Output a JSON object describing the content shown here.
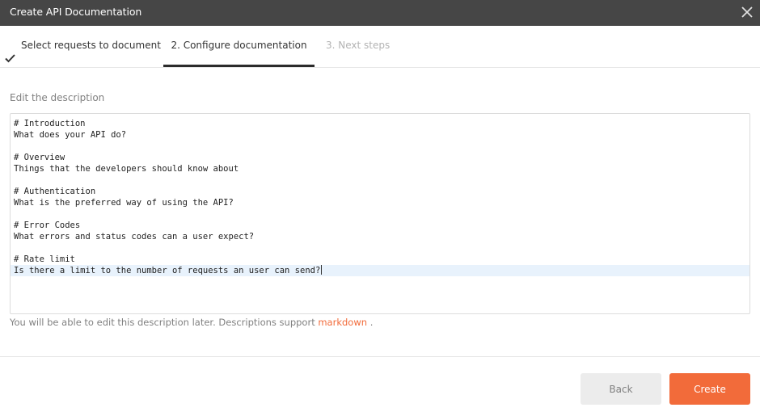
{
  "dialog": {
    "title": "Create API Documentation",
    "close_icon": "close-icon"
  },
  "tabs": [
    {
      "label": "Select requests to document",
      "state": "completed",
      "icon": "check-icon"
    },
    {
      "label": "2. Configure documentation",
      "state": "active"
    },
    {
      "label": "3. Next steps",
      "state": "disabled"
    }
  ],
  "description": {
    "label": "Edit the description",
    "lines": [
      "# Introduction",
      "What does your API do?",
      "",
      "# Overview",
      "Things that the developers should know about",
      "",
      "# Authentication",
      "What is the preferred way of using the API?",
      "",
      "# Error Codes",
      "What errors and status codes can a user expect?",
      "",
      "# Rate limit",
      "Is there a limit to the number of requests an user can send?"
    ],
    "active_line": 14
  },
  "help": {
    "text": "You will be able to edit this description later. Descriptions support",
    "link": "markdown",
    "suffix": "."
  },
  "footer": {
    "back_label": "Back",
    "create_label": "Create"
  },
  "colors": {
    "titlebar": "#464646",
    "accent": "#f26b3a",
    "active_line": "#e8f2fc"
  }
}
